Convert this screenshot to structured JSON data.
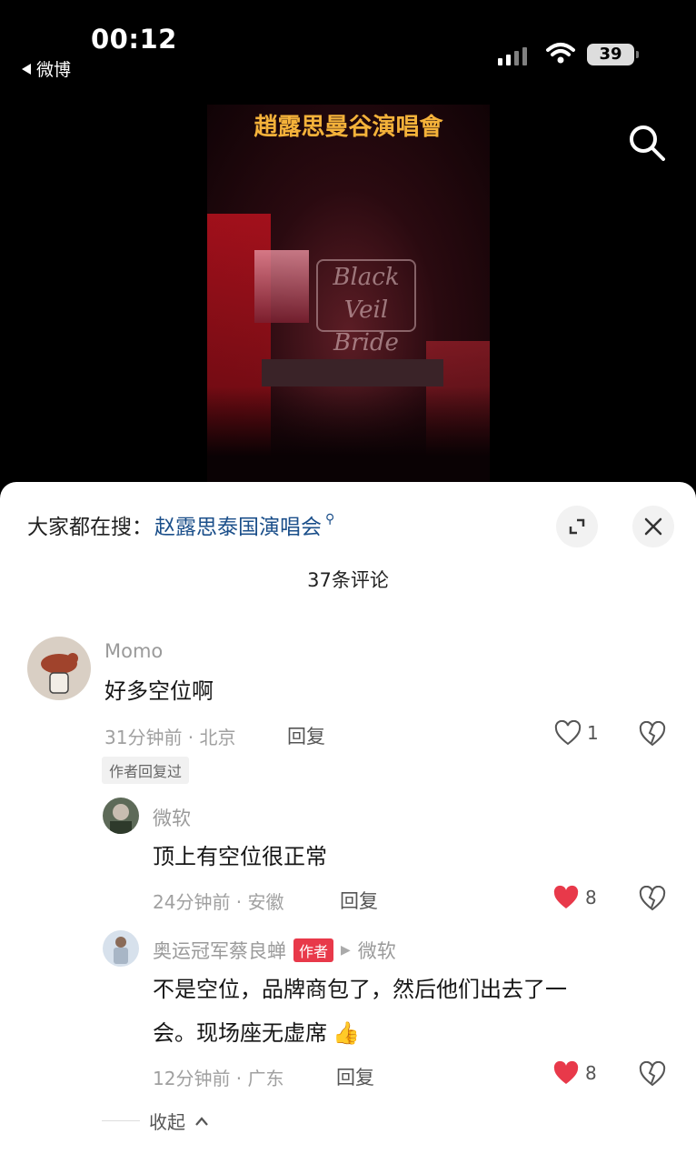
{
  "status": {
    "time": "00:12",
    "back_app": "微博",
    "battery": "39"
  },
  "video": {
    "title": "趙露思曼谷演唱會",
    "logo_text": "Black Veil Bride"
  },
  "sheet": {
    "hot_search_prefix": "大家都在搜：",
    "hot_search_term": "赵露思泰国演唱会",
    "comment_count": "37条评论",
    "collapse_label": "收起"
  },
  "comments": [
    {
      "user": "Momo",
      "text": "好多空位啊",
      "time_location": "31分钟前 · 北京",
      "reply_label": "回复",
      "likes": "1",
      "liked": false,
      "author_replied_tag": "作者回复过"
    },
    {
      "user": "微软",
      "text": "顶上有空位很正常",
      "time_location": "24分钟前 · 安徽",
      "reply_label": "回复",
      "likes": "8",
      "liked": true
    },
    {
      "user": "奥运冠军蔡良蝉",
      "author_tag": "作者",
      "reply_to": "微软",
      "text_line1": "不是空位，品牌商包了，然后他们出去了一",
      "text_line2": "会。现场座无虚席",
      "time_location": "12分钟前 · 广东",
      "reply_label": "回复",
      "likes": "8",
      "liked": true
    }
  ],
  "colors": {
    "accent_red": "#e8394a",
    "link_blue": "#1b4f8a"
  }
}
